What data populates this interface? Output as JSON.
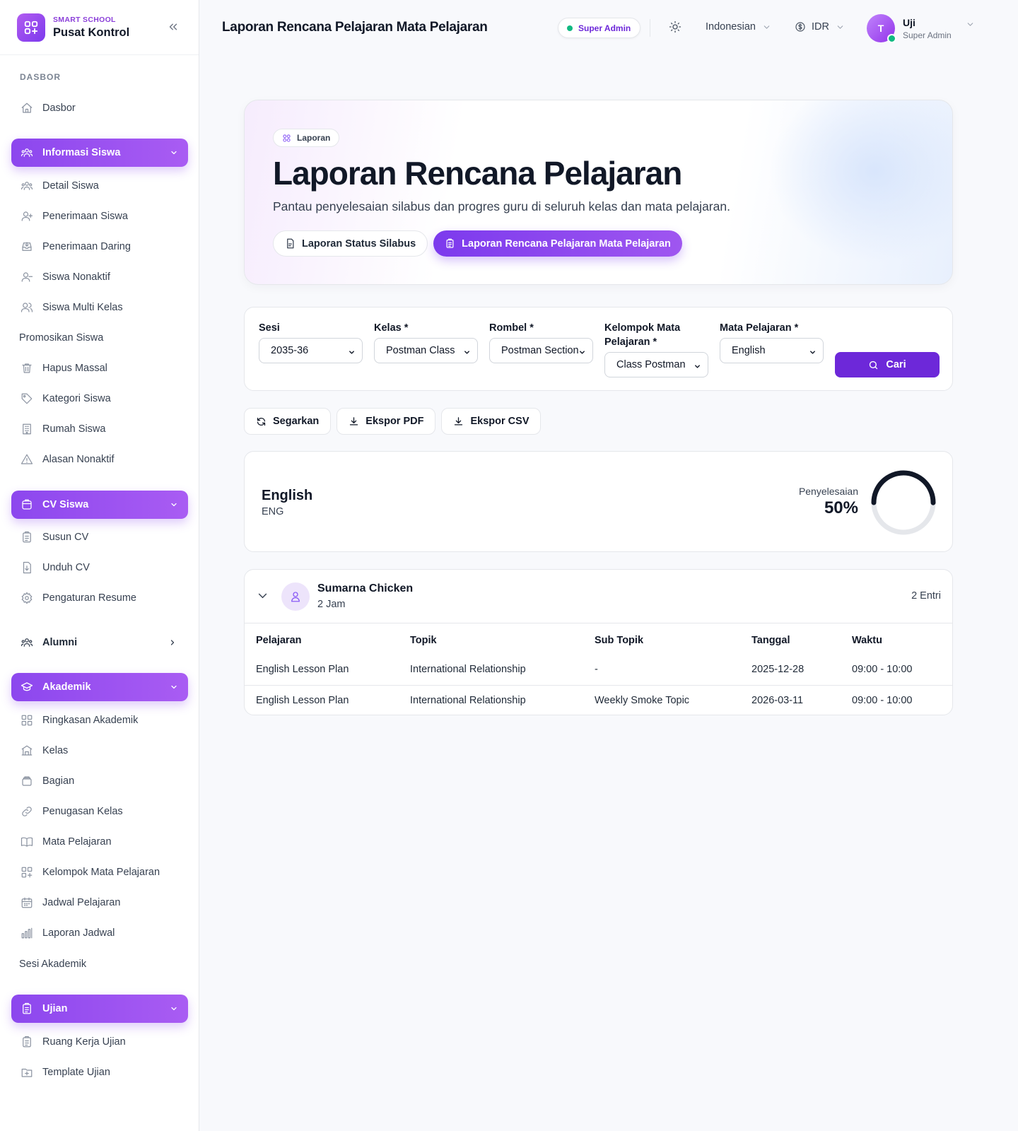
{
  "brand": {
    "small": "SMART SCHOOL",
    "title": "Pusat Kontrol"
  },
  "sidebar": {
    "section_label": "DASBOR",
    "dashboard": "Dasbor",
    "group_siswa": "Informasi Siswa",
    "siswa_items": [
      "Detail Siswa",
      "Penerimaan Siswa",
      "Penerimaan Daring",
      "Siswa Nonaktif",
      "Siswa Multi Kelas",
      "Promosikan Siswa",
      "Hapus Massal",
      "Kategori Siswa",
      "Rumah Siswa",
      "Alasan Nonaktif"
    ],
    "group_cv": "CV Siswa",
    "cv_items": [
      "Susun CV",
      "Unduh CV",
      "Pengaturan Resume"
    ],
    "alumni": "Alumni",
    "group_akademik": "Akademik",
    "akademik_items": [
      "Ringkasan Akademik",
      "Kelas",
      "Bagian",
      "Penugasan Kelas",
      "Mata Pelajaran",
      "Kelompok Mata Pelajaran",
      "Jadwal Pelajaran",
      "Laporan Jadwal",
      "Sesi Akademik"
    ],
    "group_ujian": "Ujian",
    "ujian_items": [
      "Ruang Kerja Ujian",
      "Template Ujian"
    ]
  },
  "header": {
    "title": "Laporan Rencana Pelajaran Mata Pelajaran",
    "role_pill": "Super Admin",
    "language": "Indonesian",
    "currency": "IDR",
    "user_initial": "T",
    "user_name": "Uji",
    "user_role": "Super Admin"
  },
  "hero": {
    "badge": "Laporan",
    "title": "Laporan Rencana Pelajaran",
    "description": "Pantau penyelesaian silabus dan progres guru di seluruh kelas dan mata pelajaran.",
    "tab_status": "Laporan Status Silabus",
    "tab_active": "Laporan Rencana Pelajaran Mata Pelajaran"
  },
  "filters": {
    "sesi_label": "Sesi",
    "sesi_value": "2035-36",
    "kelas_label": "Kelas *",
    "kelas_value": "Postman Class",
    "rombel_label": "Rombel *",
    "rombel_value": "Postman Section",
    "kelompok_label_1": "Kelompok Mata",
    "kelompok_label_2": "Pelajaran *",
    "kelompok_value": "Class Postman",
    "mapel_label": "Mata Pelajaran *",
    "mapel_value": "English",
    "search_button": "Cari"
  },
  "actions": {
    "refresh": "Segarkan",
    "export_pdf": "Ekspor PDF",
    "export_csv": "Ekspor CSV"
  },
  "subject": {
    "name": "English",
    "code": "ENG",
    "completion_label": "Penyelesaian",
    "completion_value": "50%",
    "completion_fraction": 0.5
  },
  "teacher": {
    "name": "Sumarna Chicken",
    "hours": "2 Jam",
    "entries": "2 Entri",
    "columns": [
      "Pelajaran",
      "Topik",
      "Sub Topik",
      "Tanggal",
      "Waktu"
    ],
    "rows": [
      [
        "English Lesson Plan",
        "International Relationship",
        "-",
        "2025-12-28",
        "09:00 - 10:00"
      ],
      [
        "English Lesson Plan",
        "International Relationship",
        "Weekly Smoke Topic",
        "2026-03-11",
        "09:00 - 10:00"
      ]
    ]
  },
  "colors": {
    "accent": "#7c3aed",
    "accent_light": "#a95cf3",
    "online": "#10b981",
    "ring_track": "#e5e7eb",
    "ring_fill": "#111827"
  }
}
